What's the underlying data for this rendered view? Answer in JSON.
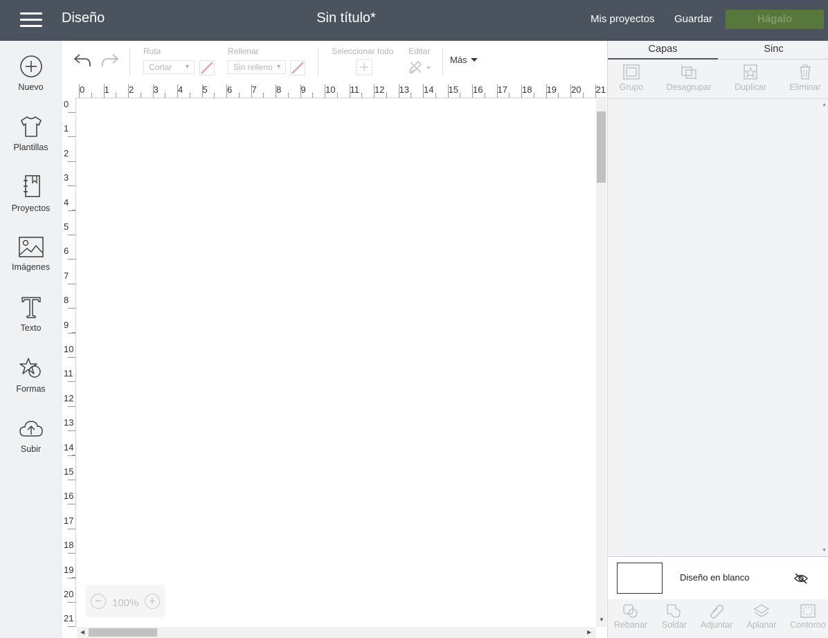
{
  "header": {
    "app_title": "Diseño",
    "doc_title": "Sin título*",
    "my_projects": "Mis proyectos",
    "save": "Guardar",
    "make_it": "Hágalo",
    "bg_color": "#4b545e",
    "make_color": "#58773d"
  },
  "sidebar": {
    "items": [
      {
        "label": "Nuevo",
        "icon": "plus-circle-icon"
      },
      {
        "label": "Plantillas",
        "icon": "tshirt-icon"
      },
      {
        "label": "Proyectos",
        "icon": "notebook-icon"
      },
      {
        "label": "Imágenes",
        "icon": "image-icon"
      },
      {
        "label": "Texto",
        "icon": "text-icon"
      },
      {
        "label": "Formas",
        "icon": "shapes-icon"
      },
      {
        "label": "Subir",
        "icon": "cloud-upload-icon"
      }
    ]
  },
  "toolbar": {
    "ruta_label": "Ruta",
    "ruta_value": "Cortar",
    "rellenar_label": "Rellenar",
    "rellenar_value": "Sin relleno",
    "select_all": "Seleccionar todo",
    "edit": "Editar",
    "more": "Más"
  },
  "rulers": {
    "top": [
      "0",
      "1",
      "2",
      "3",
      "4",
      "5",
      "6",
      "7",
      "8",
      "9",
      "10",
      "11",
      "12",
      "13",
      "14",
      "15",
      "16",
      "17",
      "18",
      "19",
      "20",
      "21"
    ],
    "left": [
      "0",
      "1",
      "2",
      "3",
      "4",
      "5",
      "6",
      "7",
      "8",
      "9",
      "10",
      "11",
      "12",
      "13",
      "14",
      "15",
      "16",
      "17",
      "18",
      "19",
      "20",
      "21"
    ]
  },
  "zoom": {
    "value": "100%",
    "minus": "−",
    "plus": "+"
  },
  "right_panel": {
    "tabs": [
      "Capas",
      "Sinc"
    ],
    "actions": [
      "Grupo",
      "Desagrupar",
      "Duplicar",
      "Eliminar"
    ],
    "blank_layer": "Diseño en blanco",
    "bottom_actions": [
      "Rebanar",
      "Soldar",
      "Adjuntar",
      "Aplanar",
      "Contorno"
    ]
  }
}
